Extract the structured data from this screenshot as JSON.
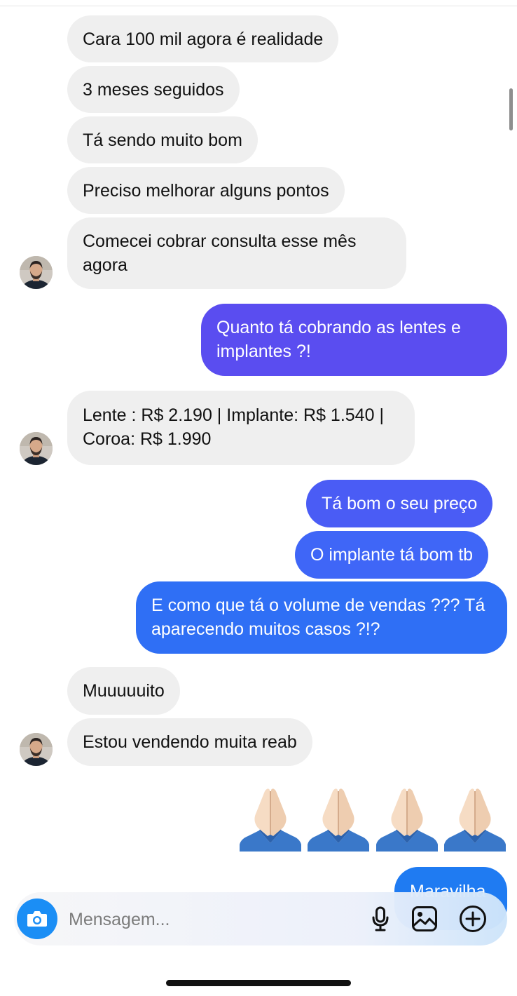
{
  "messages": {
    "m1": "Cara 100 mil agora é realidade",
    "m2": "3 meses seguidos",
    "m3": "Tá sendo muito bom",
    "m4": "Preciso melhorar alguns pontos",
    "m5": "Comecei cobrar consulta esse mês agora",
    "o1": "Quanto tá cobrando as lentes e implantes ?!",
    "m6": "Lente : R$ 2.190 | Implante: R$ 1.540 | Coroa: R$ 1.990",
    "o2": "Tá bom o seu preço",
    "o3": "O implante tá bom tb",
    "o4": "E como que tá o volume de vendas ??? Tá aparecendo muitos casos ?!?",
    "m7": "Muuuuuito",
    "m8": "Estou vendendo muita reab",
    "o5": "Maravilha"
  },
  "composer": {
    "placeholder": "Mensagem...",
    "icons": [
      "camera-icon",
      "microphone-icon",
      "gallery-icon",
      "plus-circle-icon"
    ]
  },
  "colors": {
    "incoming_bubble": "#efefef",
    "outgoing_gradient": [
      "#5a4df0",
      "#4a5cf5",
      "#3f66f7",
      "#2f6ff5",
      "#1f7bf2"
    ],
    "camera_button": "#1b8ef5"
  }
}
